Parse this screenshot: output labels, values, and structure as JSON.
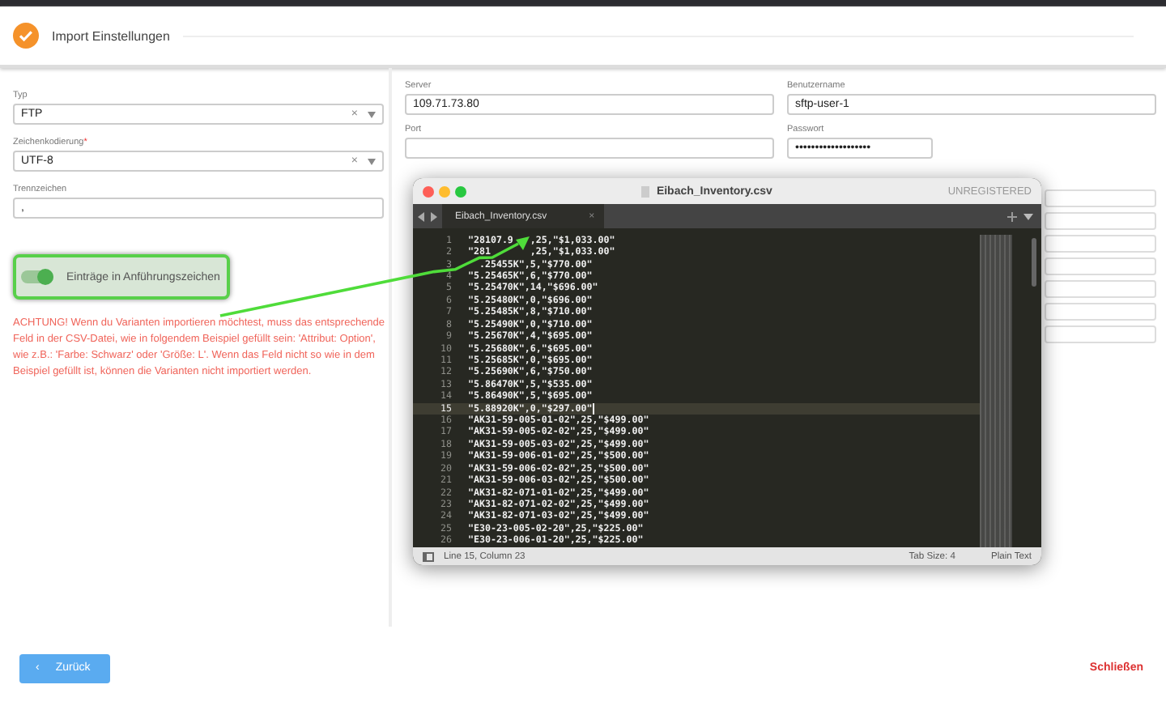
{
  "header": {
    "title": "Import Einstellungen"
  },
  "left_fields": [
    {
      "label": "Typ",
      "kind": "select",
      "value": "FTP",
      "clear": "×"
    },
    {
      "label": "Zeichenkodierung",
      "required_mark": "*",
      "kind": "select",
      "value": "UTF-8",
      "clear": "×"
    },
    {
      "label": "Trennzeichen",
      "kind": "text",
      "value": ","
    }
  ],
  "toggle": {
    "label": "Einträge in Anführungszeichen",
    "on": true
  },
  "warning": "ACHTUNG! Wenn du Varianten importieren möchtest, muss das entsprechende Feld in der CSV-Datei, wie in folgendem Beispiel gefüllt sein: 'Attribut: Option', wie z.B.: 'Farbe: Schwarz' oder 'Größe: L'. Wenn das Feld nicht so wie in dem Beispiel gefüllt ist, können die Varianten nicht importiert werden.",
  "right_fields": [
    {
      "label": "Server",
      "value": "109.71.73.80",
      "kind": "text"
    },
    {
      "label": "Benutzername",
      "value": "sftp-user-1",
      "kind": "text"
    },
    {
      "label": "Port",
      "kind": "text"
    },
    {
      "label": "Passwort",
      "value": "•••••••••••••••••••",
      "kind": "password"
    }
  ],
  "editor": {
    "title": "Eibach_Inventory.csv",
    "badge": "UNREGISTERED",
    "tab": {
      "label": "Eibach_Inventory.csv",
      "close": "×"
    },
    "lines": [
      {
        "number": "1",
        "kind": "split",
        "text": "\"28107.9",
        "text_end": ",25,\"$1,033.00\"",
        "current": false
      },
      {
        "number": "2",
        "kind": "split_wide",
        "text": "\"281",
        "text_end": ",25,\"$1,033.00\"",
        "current": false
      },
      {
        "number": "3",
        "kind": "lead_gap",
        "text": ".25455K\",5,\"$770.00\"",
        "current": false
      },
      {
        "number": "4",
        "text": "\"5.25465K\",6,\"$770.00\"",
        "current": false
      },
      {
        "number": "5",
        "text": "\"5.25470K\",14,\"$696.00\"",
        "current": false
      },
      {
        "number": "6",
        "text": "\"5.25480K\",0,\"$696.00\"",
        "current": false
      },
      {
        "number": "7",
        "text": "\"5.25485K\",8,\"$710.00\"",
        "current": false
      },
      {
        "number": "8",
        "text": "\"5.25490K\",0,\"$710.00\"",
        "current": false
      },
      {
        "number": "9",
        "text": "\"5.25670K\",4,\"$695.00\"",
        "current": false
      },
      {
        "number": "10",
        "text": "\"5.25680K\",6,\"$695.00\"",
        "current": false
      },
      {
        "number": "11",
        "text": "\"5.25685K\",0,\"$695.00\"",
        "current": false
      },
      {
        "number": "12",
        "text": "\"5.25690K\",6,\"$750.00\"",
        "current": false
      },
      {
        "number": "13",
        "text": "\"5.86470K\",5,\"$535.00\"",
        "current": false
      },
      {
        "number": "14",
        "text": "\"5.86490K\",5,\"$695.00\"",
        "current": false
      },
      {
        "number": "15",
        "text": "\"5.88920K\",0,\"$297.00\"",
        "current": true
      },
      {
        "number": "16",
        "text": "\"AK31-59-005-01-02\",25,\"$499.00\"",
        "current": false
      },
      {
        "number": "17",
        "text": "\"AK31-59-005-02-02\",25,\"$499.00\"",
        "current": false
      },
      {
        "number": "18",
        "text": "\"AK31-59-005-03-02\",25,\"$499.00\"",
        "current": false
      },
      {
        "number": "19",
        "text": "\"AK31-59-006-01-02\",25,\"$500.00\"",
        "current": false
      },
      {
        "number": "20",
        "text": "\"AK31-59-006-02-02\",25,\"$500.00\"",
        "current": false
      },
      {
        "number": "21",
        "text": "\"AK31-59-006-03-02\",25,\"$500.00\"",
        "current": false
      },
      {
        "number": "22",
        "text": "\"AK31-82-071-01-02\",25,\"$499.00\"",
        "current": false
      },
      {
        "number": "23",
        "text": "\"AK31-82-071-02-02\",25,\"$499.00\"",
        "current": false
      },
      {
        "number": "24",
        "text": "\"AK31-82-071-03-02\",25,\"$499.00\"",
        "current": false
      },
      {
        "number": "25",
        "text": "\"E30-23-005-02-20\",25,\"$225.00\"",
        "current": false
      },
      {
        "number": "26",
        "text": "\"E30-23-006-01-20\",25,\"$225.00\"",
        "current": false
      }
    ],
    "status": {
      "position": "Line 15, Column 23",
      "tab_size": "Tab Size: 4",
      "syntax": "Plain Text"
    }
  },
  "footer": {
    "back": {
      "icon": "‹",
      "label": "Zurück"
    },
    "close": "Schließen"
  }
}
